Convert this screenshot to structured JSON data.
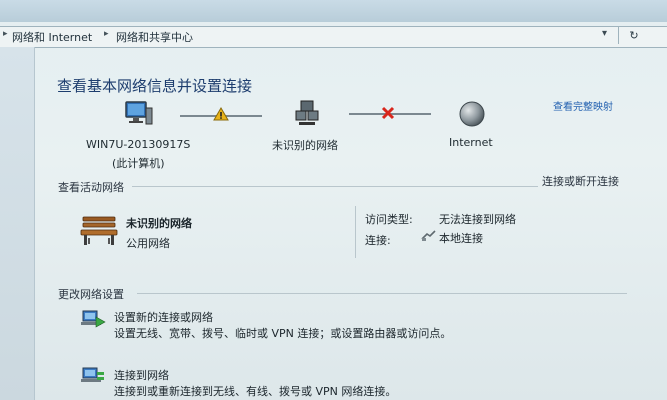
{
  "breadcrumb": {
    "items": [
      "网络和 Internet",
      "网络和共享中心"
    ],
    "refresh_symbol": "↻"
  },
  "page_title": "查看基本网络信息并设置连接",
  "full_map_link": "查看完整映射",
  "network_map": {
    "nodes": [
      {
        "label": "WIN7U-20130917S",
        "sublabel": "(此计算机)",
        "icon": "computer-icon"
      },
      {
        "label": "未识别的网络",
        "icon": "network-icon"
      },
      {
        "label": "Internet",
        "icon": "globe-icon"
      }
    ],
    "links": [
      {
        "status": "warning",
        "icon": "warning-triangle-icon"
      },
      {
        "status": "disconnected",
        "icon": "red-x-icon"
      }
    ]
  },
  "active_networks": {
    "title": "查看活动网络",
    "connect_link": "连接或断开连接",
    "network_name": "未识别的网络",
    "network_type": "公用网络",
    "access_type_label": "访问类型:",
    "access_type_value": "无法连接到网络",
    "connections_label": "连接:",
    "connections_value": "本地连接"
  },
  "change_settings": {
    "title": "更改网络设置",
    "items": [
      {
        "link": "设置新的连接或网络",
        "description": "设置无线、宽带、拨号、临时或 VPN 连接；或设置路由器或访问点。"
      },
      {
        "link": "连接到网络",
        "description": "连接到或重新连接到无线、有线、拨号或 VPN 网络连接。"
      }
    ]
  },
  "colors": {
    "link": "#2260b0",
    "title": "#1d3d6e",
    "warning": "#e8b31a",
    "error": "#d8261c"
  }
}
